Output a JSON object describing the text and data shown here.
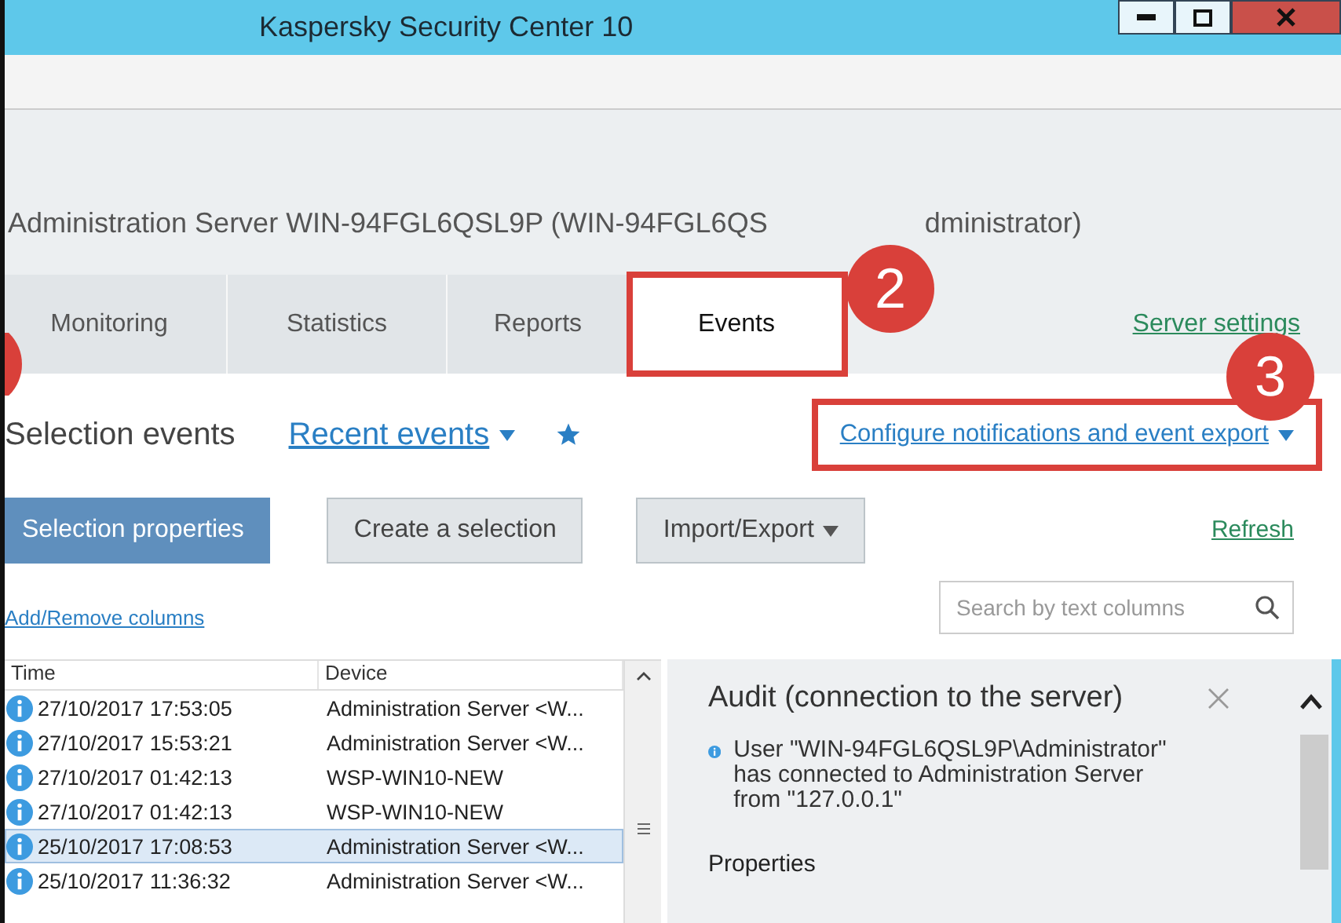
{
  "window": {
    "title": "Kaspersky Security Center 10"
  },
  "header": {
    "parts": [
      "Administration Server WIN-94FGL6QSL9P (WIN-94FGL6QS",
      "dministrator)"
    ]
  },
  "tabs": [
    {
      "label": "Monitoring",
      "selected": false,
      "highlighted": false
    },
    {
      "label": "Statistics",
      "selected": false,
      "highlighted": false
    },
    {
      "label": "Reports",
      "selected": false,
      "highlighted": false
    },
    {
      "label": "Events",
      "selected": true,
      "highlighted": true
    }
  ],
  "server_settings_link": "Server settings",
  "selection": {
    "title": "Selection events",
    "current": "Recent events",
    "configure_link": "Configure notifications and event export",
    "configure_highlighted": true
  },
  "buttons": [
    {
      "label": "Selection properties",
      "kind": "primary"
    },
    {
      "label": "Create a selection",
      "kind": "secondary"
    },
    {
      "label": "Import/Export",
      "kind": "dropdown"
    }
  ],
  "refresh_link": "Refresh",
  "columns_link": "Add/Remove columns",
  "search": {
    "placeholder": "Search by text columns"
  },
  "table": {
    "columns": [
      "Time",
      "Device"
    ],
    "rows": [
      {
        "time": "27/10/2017 17:53:05",
        "device": "Administration Server <W...",
        "selected": false
      },
      {
        "time": "27/10/2017 15:53:21",
        "device": "Administration Server <W...",
        "selected": false
      },
      {
        "time": "27/10/2017 01:42:13",
        "device": "WSP-WIN10-NEW",
        "selected": false
      },
      {
        "time": "27/10/2017 01:42:13",
        "device": "WSP-WIN10-NEW",
        "selected": false
      },
      {
        "time": "25/10/2017 17:08:53",
        "device": "Administration Server <W...",
        "selected": true
      },
      {
        "time": "25/10/2017 11:36:32",
        "device": "Administration Server <W...",
        "selected": false
      }
    ]
  },
  "details": {
    "title": "Audit (connection to the server)",
    "message": "User \"WIN-94FGL6QSL9P\\Administrator\" has connected to Administration Server from \"127.0.0.1\"",
    "section": "Properties"
  },
  "annotations": [
    {
      "number": "2"
    },
    {
      "number": "3"
    }
  ]
}
